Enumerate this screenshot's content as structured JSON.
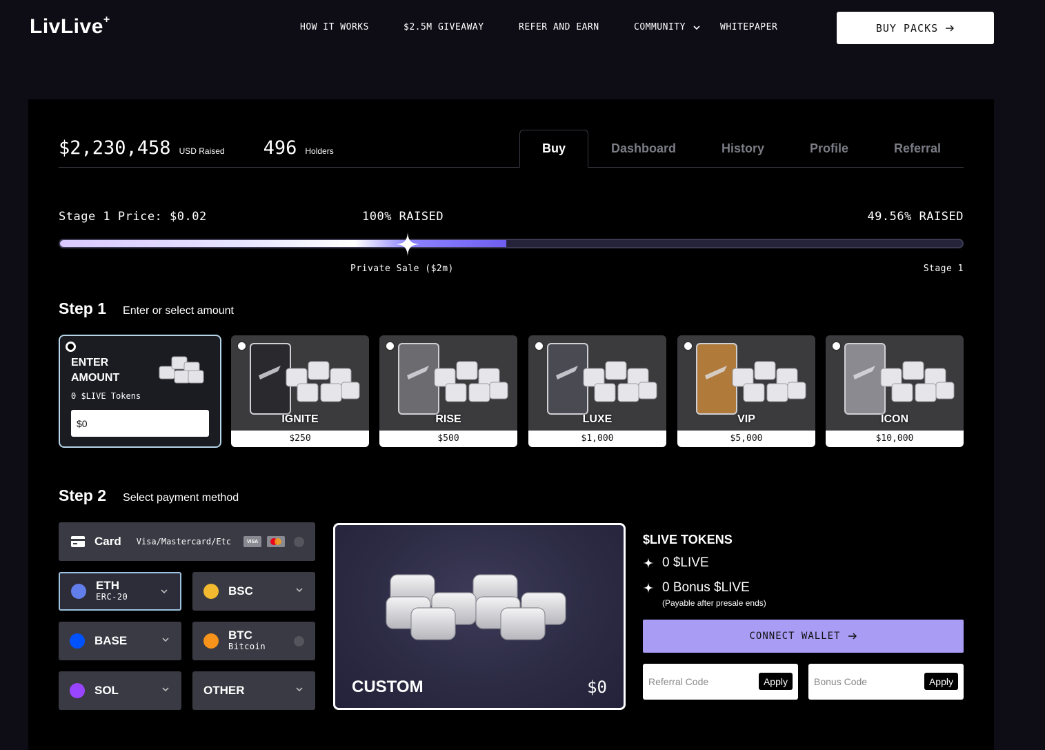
{
  "nav": {
    "logo": "LivLive",
    "logo_mark": "+",
    "links": [
      {
        "label": "HOW IT WORKS"
      },
      {
        "label": "$2.5M GIVEAWAY"
      },
      {
        "label": "REFER AND EARN"
      },
      {
        "label": "COMMUNITY",
        "has_dropdown": true
      },
      {
        "label": "WHITEPAPER"
      }
    ],
    "cta": "BUY PACKS"
  },
  "stats": {
    "raised_value": "$2,230,458",
    "raised_label": "USD Raised",
    "holders_value": "496",
    "holders_label": "Holders"
  },
  "tabs": [
    {
      "label": "Buy",
      "active": true
    },
    {
      "label": "Dashboard"
    },
    {
      "label": "History"
    },
    {
      "label": "Profile"
    },
    {
      "label": "Referral"
    }
  ],
  "stage": {
    "price_label": "Stage 1 Price: $0.02",
    "private_raised": "100% RAISED",
    "stage_raised": "49.56% RAISED",
    "private_label": "Private Sale ($2m)",
    "stage_label": "Stage 1",
    "progress_fraction": 0.495
  },
  "step1": {
    "title": "Step 1",
    "subtitle": "Enter or select amount",
    "enter": {
      "title_line1": "ENTER",
      "title_line2": "AMOUNT",
      "tokens": "0 $LIVE Tokens",
      "value": "$0"
    },
    "packs": [
      {
        "name": "IGNITE",
        "price": "$250",
        "card_color": "#2a2a2e"
      },
      {
        "name": "RISE",
        "price": "$500",
        "card_color": "#6b6b70"
      },
      {
        "name": "LUXE",
        "price": "$1,000",
        "card_color": "#4a4a52"
      },
      {
        "name": "VIP",
        "price": "$5,000",
        "card_color": "#b07a3a"
      },
      {
        "name": "ICON",
        "price": "$10,000",
        "card_color": "#8a8a90"
      }
    ]
  },
  "step2": {
    "title": "Step 2",
    "subtitle": "Select payment method",
    "card": {
      "label": "Card",
      "sub": "Visa/Mastercard/Etc",
      "visa": "VISA"
    },
    "methods": [
      {
        "label": "ETH",
        "sub": "ERC-20",
        "icon": "eth-icon",
        "color": "#627eea",
        "selected": true
      },
      {
        "label": "BSC",
        "sub": "",
        "icon": "bnb-icon",
        "color": "#f3ba2f"
      },
      {
        "label": "BASE",
        "sub": "",
        "icon": "base-icon",
        "color": "#0052ff"
      },
      {
        "label": "BTC",
        "sub": "Bitcoin",
        "icon": "btc-icon",
        "color": "#f7931a"
      },
      {
        "label": "SOL",
        "sub": "",
        "icon": "sol-icon",
        "color": "#9945ff"
      },
      {
        "label": "OTHER",
        "sub": ""
      }
    ]
  },
  "custom": {
    "label": "CUSTOM",
    "value": "$0"
  },
  "summary": {
    "heading": "$LIVE TOKENS",
    "tokens": "0 $LIVE",
    "bonus": "0 Bonus $LIVE",
    "note": "(Payable after presale ends)",
    "connect": "CONNECT WALLET",
    "referral_placeholder": "Referral Code",
    "bonus_placeholder": "Bonus Code",
    "apply": "Apply"
  }
}
